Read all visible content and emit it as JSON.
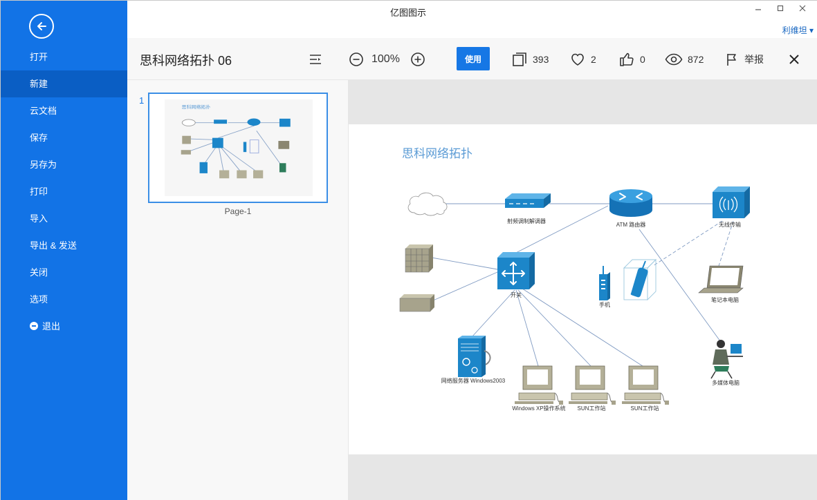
{
  "window": {
    "title": "亿图图示",
    "user": "利维坦 ▾"
  },
  "sidebar": {
    "items": [
      {
        "label": "打开"
      },
      {
        "label": "新建",
        "active": true
      },
      {
        "label": "云文档"
      },
      {
        "label": "保存"
      },
      {
        "label": "另存为"
      },
      {
        "label": "打印"
      },
      {
        "label": "导入"
      },
      {
        "label": "导出 & 发送"
      },
      {
        "label": "关闭"
      },
      {
        "label": "选项"
      },
      {
        "label": "退出"
      }
    ]
  },
  "toolbar": {
    "doc_title": "思科网络拓扑 06",
    "zoom": "100%",
    "use_label": "使用",
    "copies": "393",
    "favorites": "2",
    "likes": "0",
    "views": "872",
    "report_label": "举报"
  },
  "pages": {
    "number": "1",
    "label": "Page-1"
  },
  "diagram": {
    "title": "思科网络拓扑",
    "labels": {
      "modem": "射频调制解调器",
      "router": "ATM 路由器",
      "wireless": "无线传输",
      "switch": "开关",
      "phone": "手机",
      "laptop": "笔记本电脑",
      "server": "网络服务器 Windows2003",
      "ws_xp": "Windows XP操作系统",
      "ws_sun1": "SUN工作站",
      "ws_sun2": "SUN工作站",
      "multimedia": "多媒体电脑"
    }
  },
  "colors": {
    "sidebar": "#1273e6",
    "accent": "#1677e5",
    "diagram_title": "#5b9bd5",
    "device_blue": "#1c86c9"
  }
}
